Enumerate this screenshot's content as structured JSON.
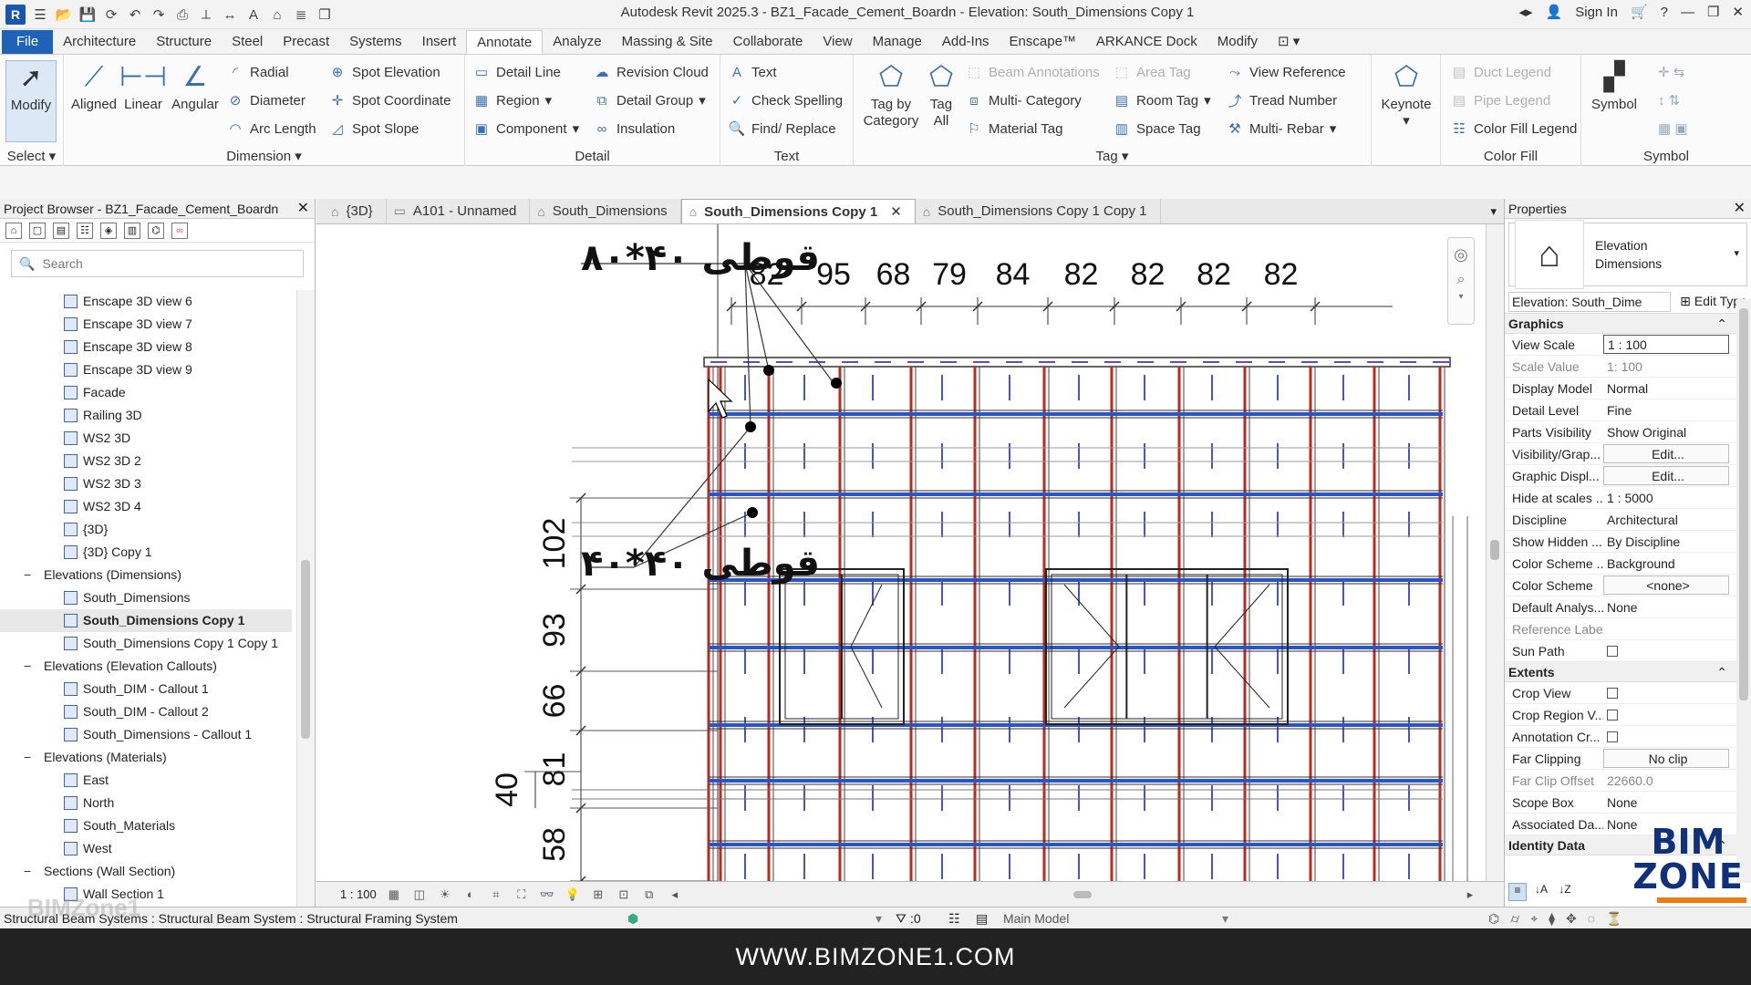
{
  "window": {
    "title": "Autodesk Revit 2025.3 - BZ1_Facade_Cement_Boardn - Elevation: South_Dimensions Copy 1",
    "sign_in": "Sign In"
  },
  "ribbon_tabs": [
    "File",
    "Architecture",
    "Structure",
    "Steel",
    "Precast",
    "Systems",
    "Insert",
    "Annotate",
    "Analyze",
    "Massing & Site",
    "Collaborate",
    "View",
    "Manage",
    "Add-Ins",
    "Enscape™",
    "ARKANCE Dock",
    "Modify"
  ],
  "active_tab": "Annotate",
  "ribbon": {
    "select": {
      "modify": "Modify",
      "label": "Select"
    },
    "dimension": {
      "aligned": "Aligned",
      "linear": "Linear",
      "angular": "Angular",
      "radial": "Radial",
      "diameter": "Diameter",
      "arc_length": "Arc Length",
      "spot_elevation": "Spot Elevation",
      "spot_coordinate": "Spot Coordinate",
      "spot_slope": "Spot Slope",
      "label": "Dimension"
    },
    "detail": {
      "detail_line": "Detail Line",
      "region": "Region",
      "component": "Component",
      "revision_cloud": "Revision Cloud",
      "detail_group": "Detail Group",
      "insulation": "Insulation",
      "label": "Detail"
    },
    "text": {
      "text": "Text",
      "check_spelling": "Check Spelling",
      "find_replace": "Find/ Replace",
      "label": "Text"
    },
    "tag": {
      "tag_by_category": "Tag by Category",
      "tag_all": "Tag All",
      "beam_annotations": "Beam Annotations",
      "multi_category": "Multi- Category",
      "material_tag": "Material Tag",
      "area_tag": "Area Tag",
      "room_tag": "Room Tag",
      "space_tag": "Space Tag",
      "view_reference": "View Reference",
      "tread_number": "Tread Number",
      "multi_rebar": "Multi- Rebar",
      "keynote": "Keynote",
      "label": "Tag"
    },
    "color_fill": {
      "duct_legend": "Duct Legend",
      "pipe_legend": "Pipe Legend",
      "color_fill_legend": "Color Fill Legend",
      "label": "Color Fill"
    },
    "symbol": {
      "symbol": "Symbol",
      "label": "Symbol"
    }
  },
  "project_browser": {
    "title": "Project Browser - BZ1_Facade_Cement_Boardn",
    "search_placeholder": "Search",
    "items": [
      {
        "label": "Enscape 3D view 6",
        "level": 2
      },
      {
        "label": "Enscape 3D view 7",
        "level": 2
      },
      {
        "label": "Enscape 3D view 8",
        "level": 2
      },
      {
        "label": "Enscape 3D view 9",
        "level": 2
      },
      {
        "label": "Facade",
        "level": 2
      },
      {
        "label": "Railing 3D",
        "level": 2
      },
      {
        "label": "WS2 3D",
        "level": 2
      },
      {
        "label": "WS2 3D 2",
        "level": 2
      },
      {
        "label": "WS2 3D 3",
        "level": 2
      },
      {
        "label": "WS2 3D 4",
        "level": 2
      },
      {
        "label": "{3D}",
        "level": 2
      },
      {
        "label": "{3D} Copy 1",
        "level": 2
      },
      {
        "label": "Elevations (Dimensions)",
        "level": 1
      },
      {
        "label": "South_Dimensions",
        "level": 2
      },
      {
        "label": "South_Dimensions Copy 1",
        "level": 2,
        "selected": true
      },
      {
        "label": "South_Dimensions Copy 1 Copy 1",
        "level": 2
      },
      {
        "label": "Elevations (Elevation Callouts)",
        "level": 1
      },
      {
        "label": "South_DIM - Callout 1",
        "level": 2
      },
      {
        "label": "South_DIM - Callout 2",
        "level": 2
      },
      {
        "label": "South_Dimensions - Callout 1",
        "level": 2
      },
      {
        "label": "Elevations (Materials)",
        "level": 1
      },
      {
        "label": "East",
        "level": 2
      },
      {
        "label": "North",
        "level": 2
      },
      {
        "label": "South_Materials",
        "level": 2
      },
      {
        "label": "West",
        "level": 2
      },
      {
        "label": "Sections (Wall Section)",
        "level": 1
      },
      {
        "label": "Wall Section 1",
        "level": 2
      }
    ]
  },
  "view_tabs": [
    {
      "label": "{3D}",
      "active": false
    },
    {
      "label": "A101 - Unnamed",
      "active": false
    },
    {
      "label": "South_Dimensions",
      "active": false
    },
    {
      "label": "South_Dimensions Copy 1",
      "active": true
    },
    {
      "label": "South_Dimensions Copy 1 Copy 1",
      "active": false
    }
  ],
  "drawing": {
    "top_dims": [
      "82",
      "95",
      "68",
      "79",
      "84",
      "82",
      "82",
      "82",
      "82"
    ],
    "side_dims": [
      "102",
      "93",
      "66",
      "81",
      "58"
    ],
    "left_dim": "40",
    "note_top": "قوطی ۴۰*۸۰",
    "note_mid": "قوطی ۴۰*۴۰"
  },
  "view_control": {
    "scale": "1 : 100"
  },
  "properties": {
    "title": "Properties",
    "type_name_1": "Elevation",
    "type_name_2": "Dimensions",
    "instance": "Elevation: South_Dime",
    "edit_type": "Edit Type",
    "sections": [
      {
        "name": "Graphics",
        "rows": [
          {
            "k": "View Scale",
            "v": "1 : 100",
            "style": "inp"
          },
          {
            "k": "Scale Value",
            "v": "1:  100",
            "dim": true
          },
          {
            "k": "Display Model",
            "v": "Normal"
          },
          {
            "k": "Detail Level",
            "v": "Fine"
          },
          {
            "k": "Parts Visibility",
            "v": "Show Original"
          },
          {
            "k": "Visibility/Grap...",
            "v": "Edit...",
            "style": "box"
          },
          {
            "k": "Graphic Displ...",
            "v": "Edit...",
            "style": "box"
          },
          {
            "k": "Hide at scales ...",
            "v": "1 : 5000"
          },
          {
            "k": "Discipline",
            "v": "Architectural"
          },
          {
            "k": "Show Hidden ...",
            "v": "By Discipline"
          },
          {
            "k": "Color Scheme ...",
            "v": "Background"
          },
          {
            "k": "Color Scheme",
            "v": "<none>",
            "style": "box"
          },
          {
            "k": "Default Analys...",
            "v": "None"
          },
          {
            "k": "Reference Label",
            "v": "",
            "dim": true
          },
          {
            "k": "Sun Path",
            "v": "",
            "style": "cb"
          }
        ]
      },
      {
        "name": "Extents",
        "rows": [
          {
            "k": "Crop View",
            "v": "",
            "style": "cb"
          },
          {
            "k": "Crop Region V...",
            "v": "",
            "style": "cb"
          },
          {
            "k": "Annotation Cr...",
            "v": "",
            "style": "cb"
          },
          {
            "k": "Far Clipping",
            "v": "No clip",
            "style": "box"
          },
          {
            "k": "Far Clip Offset",
            "v": "22660.0",
            "dim": true
          },
          {
            "k": "Scope Box",
            "v": "None"
          },
          {
            "k": "Associated Da...",
            "v": "None"
          }
        ]
      },
      {
        "name": "Identity Data",
        "rows": []
      }
    ]
  },
  "status": {
    "text": "Structural Beam Systems : Structural Beam System : Structural Framing System",
    "selection_count": ":0",
    "model": "Main Model"
  },
  "brand": {
    "banner": "WWW.BIMZONE1.COM",
    "logo_1": "BIM",
    "logo_2": "ZONE",
    "watermark": "BIMZone1"
  },
  "colors": {
    "accent": "#1e63b8",
    "stud_red": "#c0281e",
    "rail_blue": "#2a54c8",
    "logo_orange": "#f07a12"
  }
}
